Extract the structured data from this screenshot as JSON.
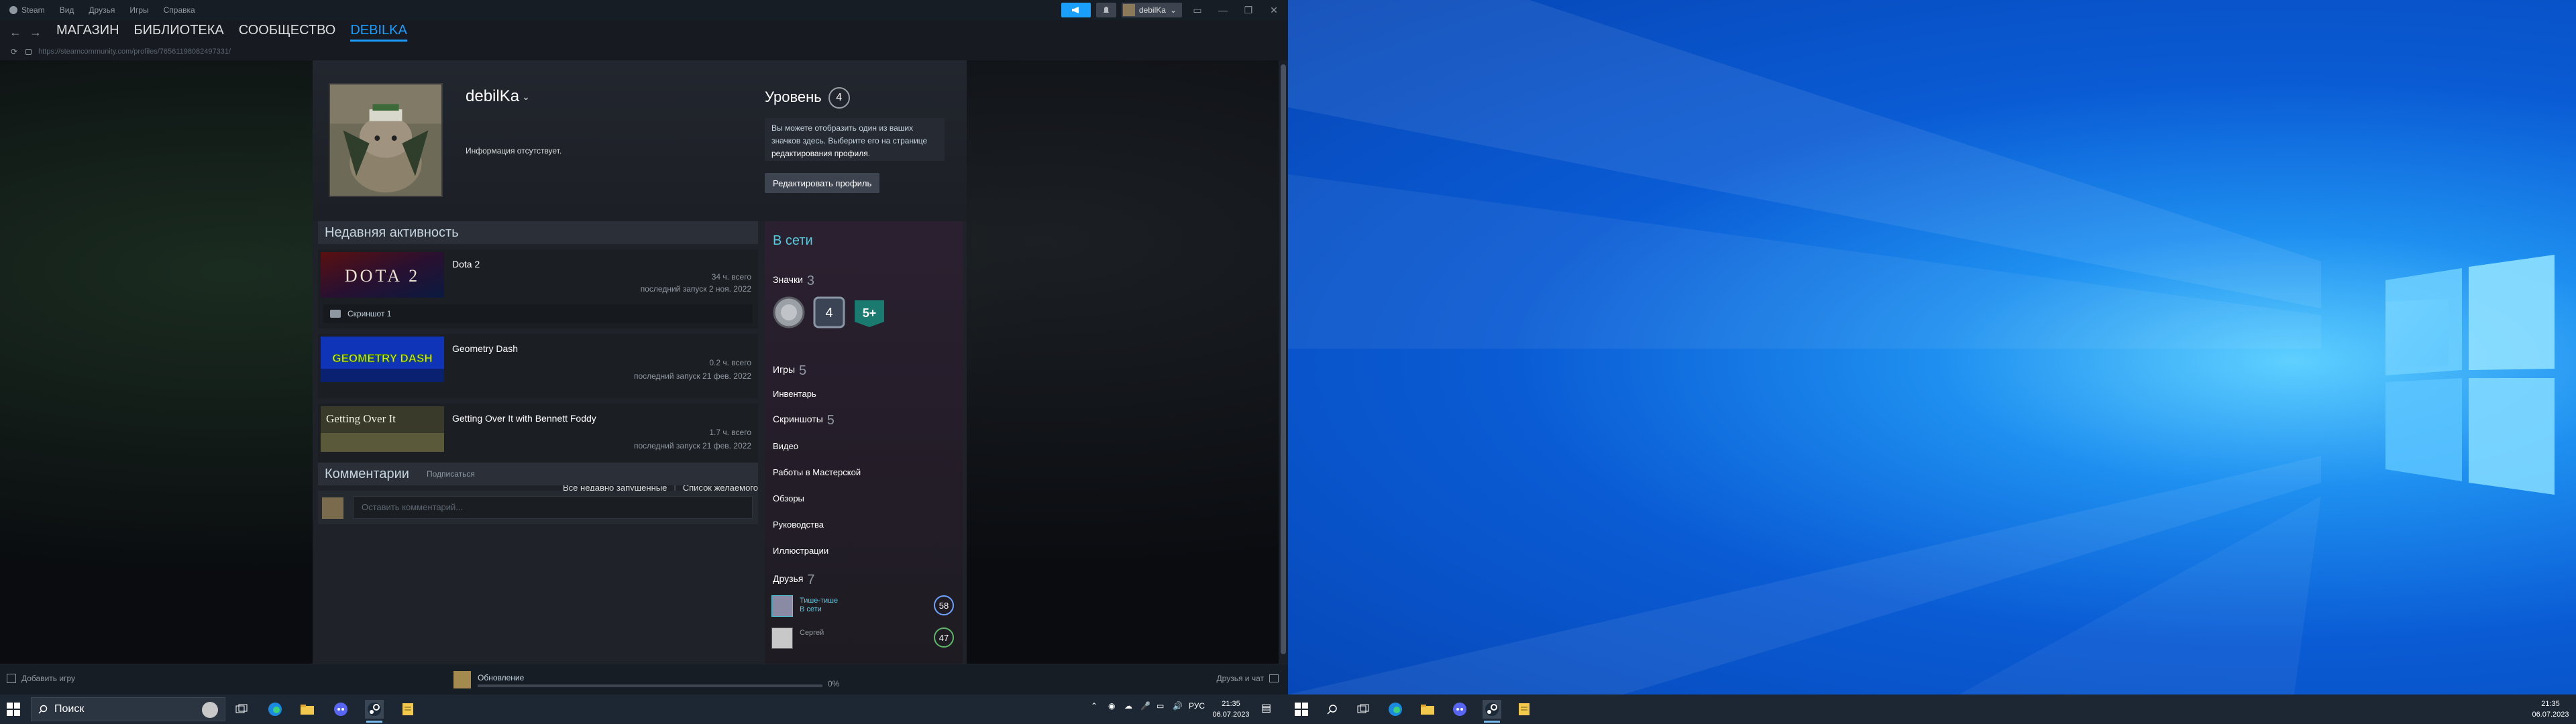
{
  "titlebar": {
    "menu": [
      "Steam",
      "Вид",
      "Друзья",
      "Игры",
      "Справка"
    ],
    "account_name": "debilKa"
  },
  "navbar": {
    "tabs": [
      "МАГАЗИН",
      "БИБЛИОТЕКА",
      "СООБЩЕСТВО",
      "DEBILKA"
    ],
    "active_tab_index": 3
  },
  "url": "https://steamcommunity.com/profiles/76561198082497331/",
  "profile": {
    "persona": "debilKa",
    "summary": "Информация отсутствует.",
    "level_label": "Уровень",
    "level": "4",
    "badge_info_pre": "Вы можете отобразить один из ваших значков здесь. Выберите его на странице ",
    "badge_info_link": "редактирования профиля",
    "badge_info_post": ".",
    "edit_button": "Редактировать профиль"
  },
  "activity": {
    "title": "Недавняя активность",
    "games": [
      {
        "name": "Dota 2",
        "hours": "34 ч. всего",
        "last": "последний запуск 2 ноя. 2022",
        "capsule": "DOTA 2"
      },
      {
        "name": "Geometry Dash",
        "hours": "0.2 ч. всего",
        "last": "последний запуск 21 фев. 2022",
        "capsule": "GEOMETRY DASH"
      },
      {
        "name": "Getting Over It with Bennett Foddy",
        "hours": "1.7 ч. всего",
        "last": "последний запуск 21 фев. 2022",
        "capsule": "Getting Over It"
      }
    ],
    "screenshot_label": "Скриншот 1",
    "link_all": "Все недавно запущенные",
    "link_wishlist": "Список желаемого"
  },
  "comments": {
    "title": "Комментарии",
    "subscribe": "Подписаться",
    "placeholder": "Оставить комментарий..."
  },
  "right_column": {
    "status": "В сети",
    "badges_label": "Значки",
    "badges_count": "3",
    "badge_texts": [
      "4",
      "5+"
    ],
    "games_label": "Игры",
    "games_count": "5",
    "inventory": "Инвентарь",
    "screenshots_label": "Скриншоты",
    "screenshots_count": "5",
    "videos": "Видео",
    "workshop": "Работы в Мастерской",
    "reviews": "Обзоры",
    "guides": "Руководства",
    "artwork": "Иллюстрации",
    "friends_label": "Друзья",
    "friends_count": "7",
    "friends": [
      {
        "name": "Тише-тише",
        "status": "В сети",
        "level": "58"
      },
      {
        "name": "Сергей",
        "status": "",
        "level": "47"
      }
    ]
  },
  "statusbar": {
    "add_game": "Добавить игру",
    "download_label": "Обновление",
    "download_percent": "0%",
    "download_progress": 0,
    "friends_chat": "Друзья и чат"
  },
  "taskbar": {
    "search_placeholder": "Поиск",
    "language": "РУС",
    "time": "21:35",
    "date": "06.07.2023"
  },
  "colors": {
    "steam_bg": "#171a21",
    "accent": "#1a9fff",
    "online": "#57cbde",
    "desktop_blue": "#0a5bd4"
  }
}
